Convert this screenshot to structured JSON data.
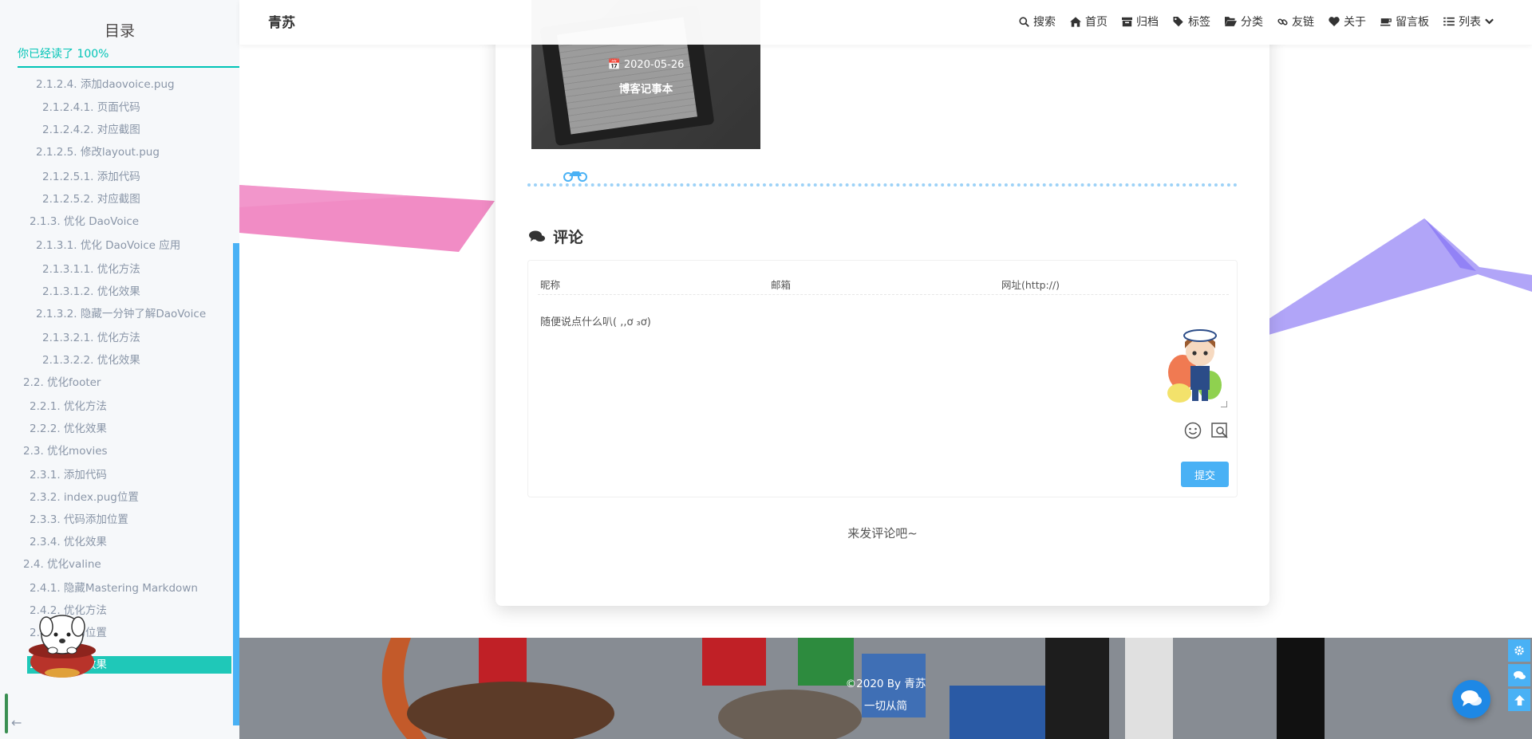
{
  "sidebar": {
    "title": "目录",
    "progress": "你已经读了  100%",
    "items": [
      {
        "label": "2.1.2.4. 添加daovoice.pug"
      },
      {
        "label": "2.1.2.4.1. 页面代码"
      },
      {
        "label": "2.1.2.4.2. 对应截图"
      },
      {
        "label": "2.1.2.5. 修改layout.pug"
      },
      {
        "label": "2.1.2.5.1. 添加代码"
      },
      {
        "label": "2.1.2.5.2. 对应截图"
      },
      {
        "label": "2.1.3. 优化 DaoVoice"
      },
      {
        "label": "2.1.3.1. 优化 DaoVoice 应用"
      },
      {
        "label": "2.1.3.1.1. 优化方法"
      },
      {
        "label": "2.1.3.1.2. 优化效果"
      },
      {
        "label": "2.1.3.2. 隐藏一分钟了解DaoVoice"
      },
      {
        "label": "2.1.3.2.1. 优化方法"
      },
      {
        "label": "2.1.3.2.2. 优化效果"
      },
      {
        "label": "2.2. 优化footer"
      },
      {
        "label": "2.2.1. 优化方法"
      },
      {
        "label": "2.2.2. 优化效果"
      },
      {
        "label": "2.3. 优化movies"
      },
      {
        "label": "2.3.1. 添加代码"
      },
      {
        "label": "2.3.2. index.pug位置"
      },
      {
        "label": "2.3.3. 代码添加位置"
      },
      {
        "label": "2.3.4. 优化效果"
      },
      {
        "label": "2.4. 优化valine"
      },
      {
        "label": "2.4.1. 隐藏Mastering Markdown"
      },
      {
        "label": "2.4.2. 优化方法"
      },
      {
        "label": "2.4.3. 代码位置"
      },
      {
        "label": "2.4.4. 优化效果"
      }
    ]
  },
  "header": {
    "brand": "青苏",
    "menu": [
      {
        "label": "搜索",
        "icon": "search-icon"
      },
      {
        "label": "首页",
        "icon": "home-icon"
      },
      {
        "label": "归档",
        "icon": "archive-icon"
      },
      {
        "label": "标签",
        "icon": "tags-icon"
      },
      {
        "label": "分类",
        "icon": "folder-open-icon"
      },
      {
        "label": "友链",
        "icon": "link-icon"
      },
      {
        "label": "关于",
        "icon": "heart-icon"
      },
      {
        "label": "留言板",
        "icon": "coffee-icon"
      },
      {
        "label": "列表",
        "icon": "list-icon"
      }
    ]
  },
  "post": {
    "date": "2020-05-26",
    "title": "博客记事本"
  },
  "comments": {
    "heading": "评论",
    "nickname_placeholder": "昵称",
    "email_placeholder": "邮箱",
    "url_placeholder": "网址(http://)",
    "textarea_placeholder": "随便说点什么叭( ,,ơ ₃ơ)",
    "submit_label": "提交",
    "empty_message": "来发评论吧~"
  },
  "footer": {
    "copyright": "©2020 By 青苏",
    "motto": "一切从简"
  },
  "colors": {
    "accent": "#49b1f5",
    "toc_active": "#1fc8b8",
    "progress": "#00c4b6"
  }
}
